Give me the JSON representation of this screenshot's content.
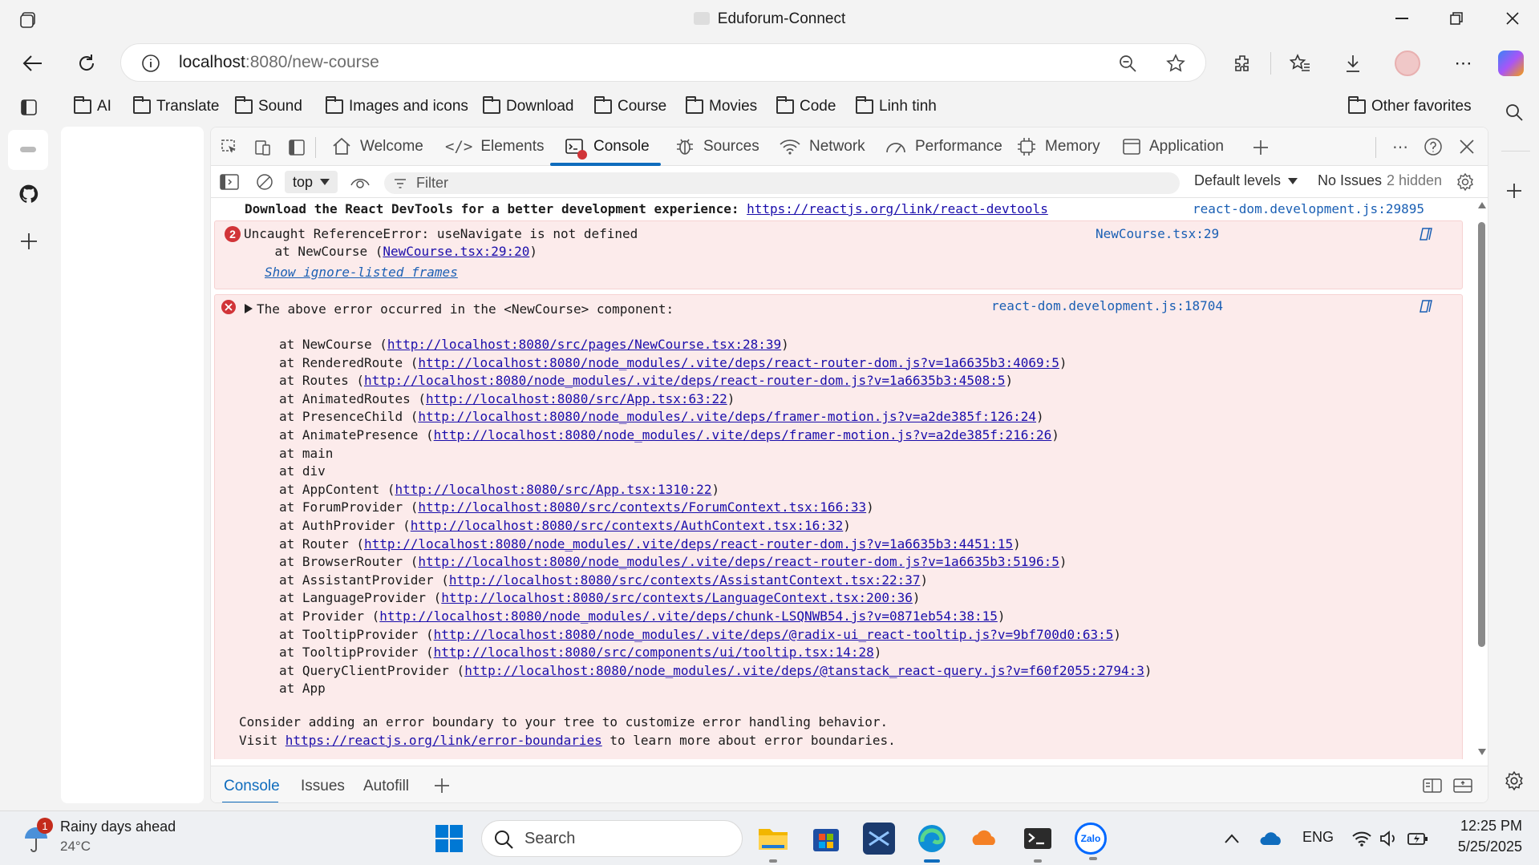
{
  "window": {
    "title": "Eduforum-Connect"
  },
  "address": {
    "host": "localhost",
    "path": ":8080/new-course"
  },
  "favorites": [
    "AI",
    "Translate",
    "Sound",
    "Images and icons",
    "Download",
    "Course",
    "Movies",
    "Code",
    "Linh tinh"
  ],
  "other_favorites": "Other favorites",
  "devtools": {
    "tabs": [
      "Welcome",
      "Elements",
      "Console",
      "Sources",
      "Network",
      "Performance",
      "Memory",
      "Application"
    ],
    "context": "top",
    "filter_placeholder": "Filter",
    "levels": "Default levels",
    "issues": "No Issues",
    "hidden": "2 hidden",
    "drawer_tabs": [
      "Console",
      "Issues",
      "Autofill"
    ]
  },
  "console": {
    "info_msg": "Download the React DevTools for a better development experience: ",
    "info_link": "https://reactjs.org/link/react-devtools",
    "info_src": "react-dom.development.js:29895",
    "err1_count": "2",
    "err1_msg": "Uncaught ReferenceError: useNavigate is not defined",
    "err1_at": "    at NewCourse (",
    "err1_at_link": "NewCourse.tsx:29:20",
    "err1_at_close": ")",
    "err1_src": "NewCourse.tsx:29",
    "show_ignored": "Show ignore-listed frames",
    "err2_msg": "The above error occurred in the <NewCourse> component:",
    "err2_src": "react-dom.development.js:18704",
    "stack": [
      {
        "name": "at NewCourse",
        "link": "http://localhost:8080/src/pages/NewCourse.tsx:28:39"
      },
      {
        "name": "at RenderedRoute",
        "link": "http://localhost:8080/node_modules/.vite/deps/react-router-dom.js?v=1a6635b3:4069:5"
      },
      {
        "name": "at Routes",
        "link": "http://localhost:8080/node_modules/.vite/deps/react-router-dom.js?v=1a6635b3:4508:5"
      },
      {
        "name": "at AnimatedRoutes",
        "link": "http://localhost:8080/src/App.tsx:63:22"
      },
      {
        "name": "at PresenceChild",
        "link": "http://localhost:8080/node_modules/.vite/deps/framer-motion.js?v=a2de385f:126:24"
      },
      {
        "name": "at AnimatePresence",
        "link": "http://localhost:8080/node_modules/.vite/deps/framer-motion.js?v=a2de385f:216:26"
      },
      {
        "name": "at main",
        "link": ""
      },
      {
        "name": "at div",
        "link": ""
      },
      {
        "name": "at AppContent",
        "link": "http://localhost:8080/src/App.tsx:1310:22"
      },
      {
        "name": "at ForumProvider",
        "link": "http://localhost:8080/src/contexts/ForumContext.tsx:166:33"
      },
      {
        "name": "at AuthProvider",
        "link": "http://localhost:8080/src/contexts/AuthContext.tsx:16:32"
      },
      {
        "name": "at Router",
        "link": "http://localhost:8080/node_modules/.vite/deps/react-router-dom.js?v=1a6635b3:4451:15"
      },
      {
        "name": "at BrowserRouter",
        "link": "http://localhost:8080/node_modules/.vite/deps/react-router-dom.js?v=1a6635b3:5196:5"
      },
      {
        "name": "at AssistantProvider",
        "link": "http://localhost:8080/src/contexts/AssistantContext.tsx:22:37"
      },
      {
        "name": "at LanguageProvider",
        "link": "http://localhost:8080/src/contexts/LanguageContext.tsx:200:36"
      },
      {
        "name": "at Provider",
        "link": "http://localhost:8080/node_modules/.vite/deps/chunk-LSQNWB54.js?v=0871eb54:38:15"
      },
      {
        "name": "at TooltipProvider",
        "link": "http://localhost:8080/node_modules/.vite/deps/@radix-ui_react-tooltip.js?v=9bf700d0:63:5"
      },
      {
        "name": "at TooltipProvider",
        "link": "http://localhost:8080/src/components/ui/tooltip.tsx:14:28"
      },
      {
        "name": "at QueryClientProvider",
        "link": "http://localhost:8080/node_modules/.vite/deps/@tanstack_react-query.js?v=f60f2055:2794:3"
      },
      {
        "name": "at App",
        "link": ""
      }
    ],
    "boundary_line1": "Consider adding an error boundary to your tree to customize error handling behavior.",
    "boundary_prefix": "Visit ",
    "boundary_link": "https://reactjs.org/link/error-boundaries",
    "boundary_suffix": " to learn more about error boundaries."
  },
  "taskbar": {
    "weather_badge": "1",
    "weather_title": "Rainy days ahead",
    "weather_temp": "24°C",
    "search_placeholder": "Search",
    "lang": "ENG",
    "time": "12:25 PM",
    "date": "5/25/2025",
    "zalo_label": "Zalo"
  },
  "colors": {
    "accent": "#0f6cbd",
    "error_bg": "#fcebeb",
    "error_red": "#d13438",
    "link": "#1a0dab"
  }
}
